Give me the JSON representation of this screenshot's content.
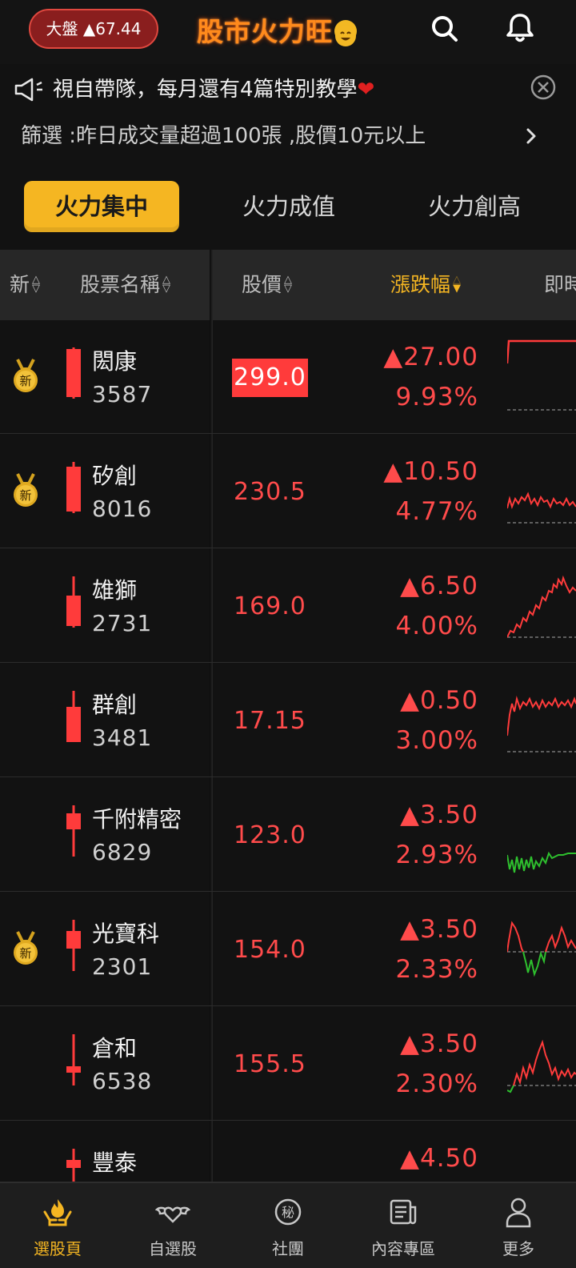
{
  "topbar": {
    "index_label": "大盤 ▲67.44",
    "brand_title": "股市火力旺",
    "icons": {
      "search": "search-icon",
      "notify": "bell-icon",
      "emoji": "smile-emoji-icon"
    }
  },
  "marquee": {
    "text": "視自帶隊，每月還有4篇特別教學",
    "heart": "❤"
  },
  "filter": {
    "text": "篩選 :昨日成交量超過100張 ,股價10元以上"
  },
  "tabs": [
    {
      "label": "火力集中",
      "active": true
    },
    {
      "label": "火力成值",
      "active": false
    },
    {
      "label": "火力創高",
      "active": false
    }
  ],
  "columns": {
    "new": "新",
    "name": "股票名稱",
    "price": "股價",
    "change": "漲跌幅",
    "realtime": "即時"
  },
  "rows": [
    {
      "name": "閎康",
      "code": "3587",
      "price": "299.0",
      "change": "▲27.00",
      "pct": "9.93%",
      "new_badge": "新",
      "is_new": true,
      "flash": true
    },
    {
      "name": "矽創",
      "code": "8016",
      "price": "230.5",
      "change": "▲10.50",
      "pct": "4.77%",
      "new_badge": "新",
      "is_new": true,
      "flash": false
    },
    {
      "name": "雄獅",
      "code": "2731",
      "price": "169.0",
      "change": "▲6.50",
      "pct": "4.00%",
      "is_new": false,
      "flash": false
    },
    {
      "name": "群創",
      "code": "3481",
      "price": "17.15",
      "change": "▲0.50",
      "pct": "3.00%",
      "is_new": false,
      "flash": false
    },
    {
      "name": "千附精密",
      "code": "6829",
      "price": "123.0",
      "change": "▲3.50",
      "pct": "2.93%",
      "is_new": false,
      "flash": false
    },
    {
      "name": "光寶科",
      "code": "2301",
      "price": "154.0",
      "change": "▲3.50",
      "pct": "2.33%",
      "new_badge": "新",
      "is_new": true,
      "flash": false
    },
    {
      "name": "倉和",
      "code": "6538",
      "price": "155.5",
      "change": "▲3.50",
      "pct": "2.30%",
      "is_new": false,
      "flash": false
    },
    {
      "name": "豐泰",
      "code": "",
      "price": "",
      "change": "▲4.50",
      "pct": "",
      "is_new": false,
      "flash": false
    }
  ],
  "bottom_nav": [
    {
      "label": "選股頁",
      "icon": "fire-hands-icon",
      "active": true
    },
    {
      "label": "自選股",
      "icon": "winged-heart-icon",
      "active": false
    },
    {
      "label": "社團",
      "icon": "secret-circle-icon",
      "active": false
    },
    {
      "label": "內容專區",
      "icon": "news-icon",
      "active": false
    },
    {
      "label": "更多",
      "icon": "person-icon",
      "active": false
    }
  ],
  "colors": {
    "up": "#ff4b4b",
    "down": "#2ec02e",
    "accent": "#f5b622",
    "background": "#121212"
  }
}
